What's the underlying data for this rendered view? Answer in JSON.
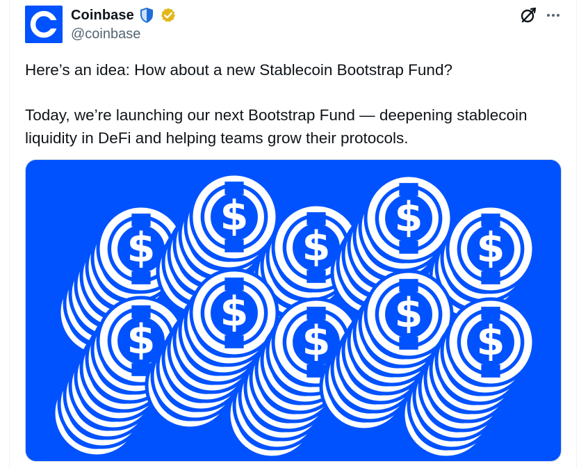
{
  "author": {
    "name": "Coinbase",
    "handle": "@coinbase"
  },
  "icons": {
    "avatar": "coinbase-logo",
    "shield": "government-affiliation-shield-icon",
    "verified": "gold-verified-badge-icon",
    "grok": "grok-icon",
    "more": "more-options-icon"
  },
  "colors": {
    "brand_blue": "#0052ff",
    "verified_gold": "#e2b719",
    "handle_gray": "#536471"
  },
  "tweet": {
    "paragraph_1": "Here’s an idea: How about a new Stablecoin Bootstrap Fund?",
    "paragraph_2": "Today, we’re launching our next Bootstrap Fund — deepening stablecoin liquidity in DeFi and helping teams grow their protocols."
  },
  "media": {
    "glyph": "$"
  }
}
